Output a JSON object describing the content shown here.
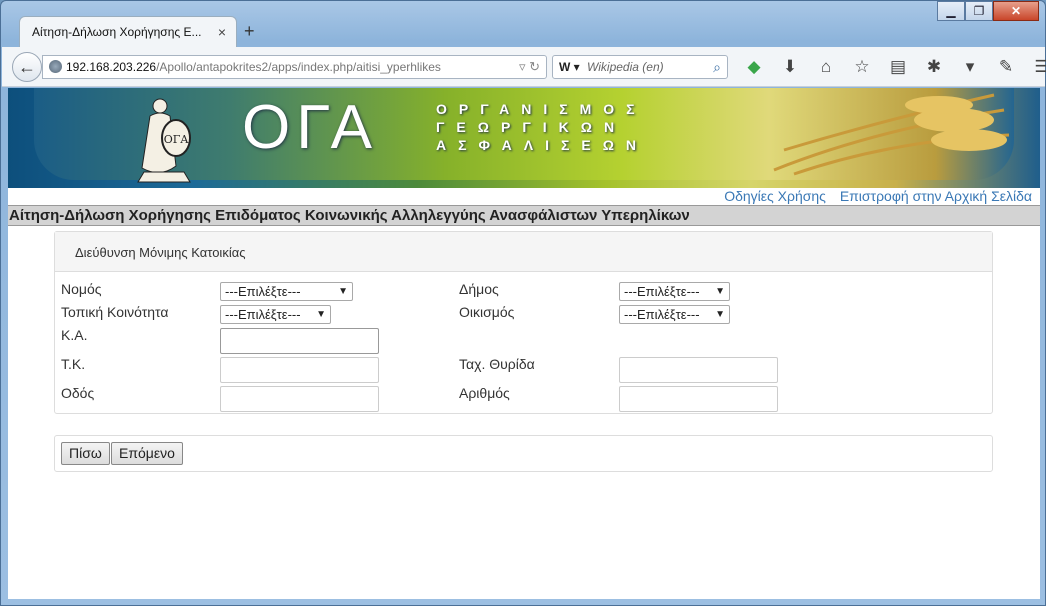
{
  "browser": {
    "tab_title": "Αίτηση-Δήλωση Χορήγησης Ε...",
    "tab_close": "×",
    "new_tab": "+",
    "url_host": "192.168.203.226",
    "url_path": "/Apollo/antapokrites2/apps/index.php/aitisi_yperhlikes",
    "search_engine": "W",
    "search_placeholder": "Wikipedia (en)",
    "window_controls": [
      "▁",
      "❐",
      "✕"
    ]
  },
  "banner": {
    "logo_text": "ΟΓΑ",
    "org_line1": "ΟΡΓΑΝΙΣΜΟΣ",
    "org_line2": "ΓΕΩΡΓΙΚΩΝ",
    "org_line3": "ΑΣΦΑΛΙΣΕΩΝ"
  },
  "links": {
    "help": "Οδηγίες Χρήσης",
    "home": "Επιστροφή στην Αρχική Σελίδα"
  },
  "page_title": "Αίτηση-Δήλωση Χορήγησης Επιδόματος Κοινωνικής Αλληλεγγύης Ανασφάλιστων Υπερηλίκων",
  "address": {
    "heading": "Διεύθυνση Μόνιμης Κατοικίας",
    "nomos_label": "Νομός",
    "nomos_value": "---Επιλέξτε---",
    "dimos_label": "Δήμος",
    "dimos_value": "---Επιλέξτε---",
    "koinotita_label": "Τοπική Κοινότητα",
    "koinotita_value": "---Επιλέξτε---",
    "oikismos_label": "Οικισμός",
    "oikismos_value": "---Επιλέξτε---",
    "ka_label": "Κ.Α.",
    "tk_label": "Τ.Κ.",
    "pobox_label": "Ταχ. Θυρίδα",
    "street_label": "Οδός",
    "number_label": "Αριθμός"
  },
  "buttons": {
    "back": "Πίσω",
    "next": "Επόμενο"
  }
}
